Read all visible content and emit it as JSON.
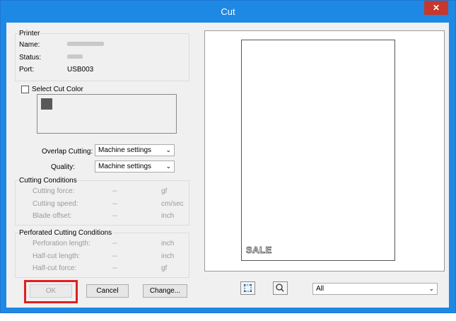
{
  "window": {
    "title": "Cut",
    "close_symbol": "✕"
  },
  "printer": {
    "group_label": "Printer",
    "name_label": "Name:",
    "status_label": "Status:",
    "port_label": "Port:",
    "port_value": "USB003"
  },
  "select_cut_color": {
    "label": "Select Cut Color",
    "checked": false,
    "swatch_color": "#595959"
  },
  "overlap_cutting": {
    "label": "Overlap Cutting:",
    "value": "Machine settings"
  },
  "quality": {
    "label": "Quality:",
    "value": "Machine settings"
  },
  "cutting_conditions": {
    "group_label": "Cutting Conditions",
    "rows": [
      {
        "label": "Cutting force:",
        "value": "--",
        "unit": "gf"
      },
      {
        "label": "Cutting speed:",
        "value": "--",
        "unit": "cm/sec"
      },
      {
        "label": "Blade offset:",
        "value": "--",
        "unit": "inch"
      }
    ]
  },
  "perforated": {
    "group_label": "Perforated Cutting Conditions",
    "rows": [
      {
        "label": "Perforation length:",
        "value": "--",
        "unit": "inch"
      },
      {
        "label": "Half-cut length:",
        "value": "--",
        "unit": "inch"
      },
      {
        "label": "Half-cut force:",
        "value": "--",
        "unit": "gf"
      }
    ]
  },
  "buttons": {
    "ok": "OK",
    "cancel": "Cancel",
    "change": "Change..."
  },
  "preview": {
    "sale_text": "SALE"
  },
  "view_select": {
    "value": "All"
  },
  "icons": {
    "fit": "fit-to-page-icon",
    "zoom": "magnifier-icon",
    "chevron": "⌄"
  }
}
